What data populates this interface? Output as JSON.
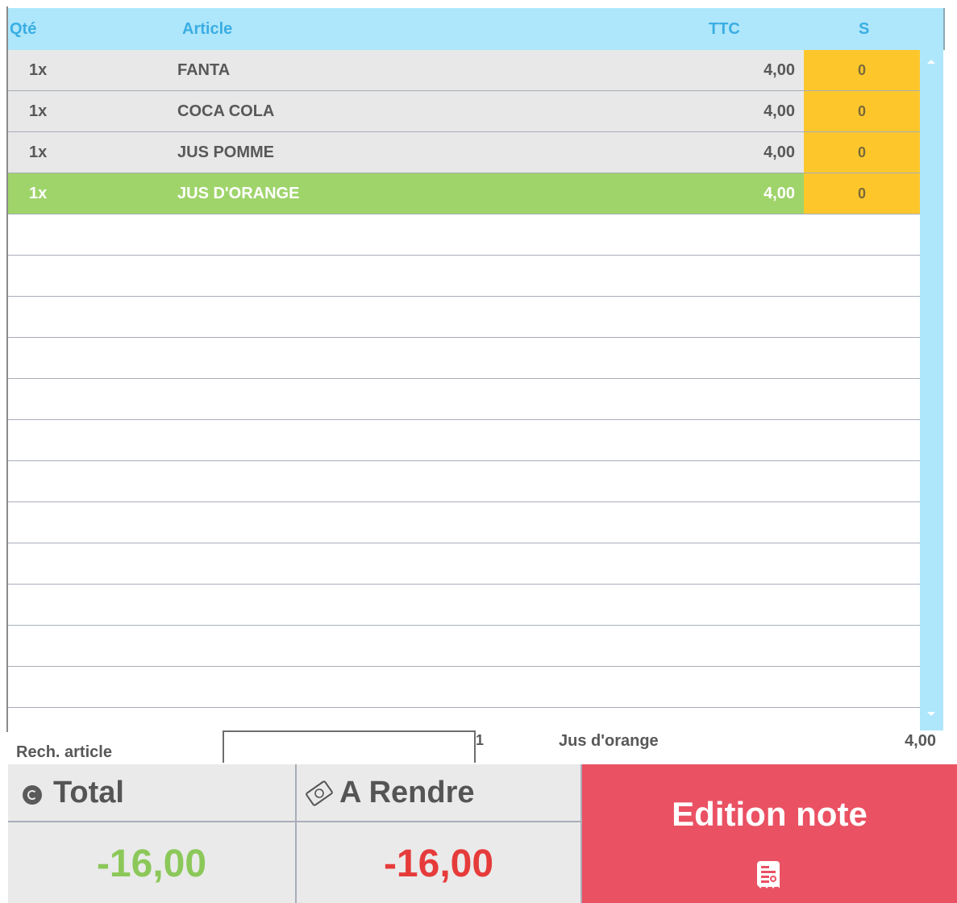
{
  "table": {
    "headers": {
      "qty": "Qté",
      "article": "Article",
      "ttc": "TTC",
      "s": "S"
    },
    "rows": [
      {
        "qty": "1x",
        "article": "FANTA",
        "ttc": "4,00",
        "s": "0",
        "selected": false
      },
      {
        "qty": "1x",
        "article": "COCA COLA",
        "ttc": "4,00",
        "s": "0",
        "selected": false
      },
      {
        "qty": "1x",
        "article": "JUS POMME",
        "ttc": "4,00",
        "s": "0",
        "selected": false
      },
      {
        "qty": "1x",
        "article": "JUS D'ORANGE",
        "ttc": "4,00",
        "s": "0",
        "selected": true
      }
    ]
  },
  "search": {
    "label": "Rech. article",
    "value": "",
    "last_qty": "1",
    "last_article": "Jus d'orange",
    "last_price": "4,00"
  },
  "total": {
    "label": "Total",
    "value": "-16,00",
    "icon": "coin-icon"
  },
  "rendre": {
    "label": "A Rendre",
    "value": "-16,00",
    "icon": "banknote-icon"
  },
  "edition": {
    "label": "Edition note",
    "icon": "receipt-icon"
  },
  "colors": {
    "header_bg": "#aee6fb",
    "header_text": "#3aaee3",
    "row_bg": "#e8e8e8",
    "selected_row": "#9fd46b",
    "s_column": "#fdc72c",
    "total_value": "#8bc859",
    "rendre_value": "#e63b3b",
    "edition_bg": "#ea5163"
  }
}
